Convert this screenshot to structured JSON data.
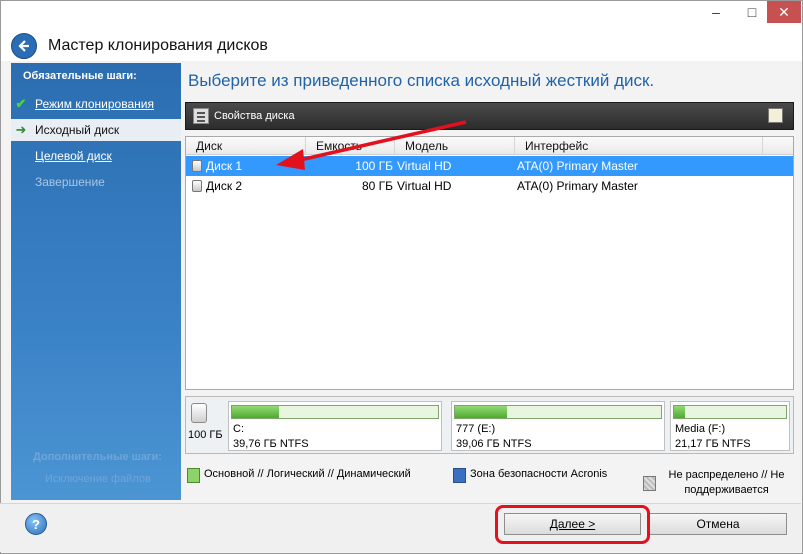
{
  "window": {
    "title": "Мастер клонирования дисков",
    "controls": {
      "minimize": "–",
      "maximize": "□",
      "close": "✕"
    }
  },
  "sidebar": {
    "heading": "Обязательные шаги:",
    "items": [
      {
        "label": "Режим клонирования",
        "state": "done",
        "icon": "check-icon"
      },
      {
        "label": "Исходный диск",
        "state": "active",
        "icon": "arrow-right-icon"
      },
      {
        "label": "Целевой диск",
        "state": "next"
      },
      {
        "label": "Завершение",
        "state": "disabled"
      }
    ],
    "faded_heading": "Дополнительные шаги:",
    "faded_item": "Исключение файлов"
  },
  "main": {
    "instruction": "Выберите из приведенного списка исходный жесткий диск.",
    "toolbar": {
      "label": "Свойства диска"
    },
    "columns": [
      "Диск",
      "Емкость",
      "Модель",
      "Интерфейс"
    ],
    "rows": [
      {
        "disk": "Диск 1",
        "capacity": "100 ГБ",
        "model": "Virtual HD",
        "interface": "ATA(0) Primary Master",
        "selected": true
      },
      {
        "disk": "Диск 2",
        "capacity": "80 ГБ",
        "model": "Virtual HD",
        "interface": "ATA(0) Primary Master",
        "selected": false
      }
    ]
  },
  "diskmap": {
    "capacity": "100 ГБ",
    "partitions": [
      {
        "label": "C:",
        "info": "39,76 ГБ  NTFS",
        "used_fraction": 0.23
      },
      {
        "label": "777 (E:)",
        "info": "39,06 ГБ  NTFS",
        "used_fraction": 0.25
      },
      {
        "label": "Media (F:)",
        "info": "21,17 ГБ  NTFS",
        "used_fraction": 0.1
      }
    ]
  },
  "legend": {
    "primary": "Основной // Логический // Динамический",
    "acronis": "Зона безопасности Acronis",
    "unallocated": "Не распределено // Не поддерживается"
  },
  "footer": {
    "help": "?",
    "next": "Далее >",
    "cancel": "Отмена"
  },
  "colors": {
    "accent": "#1f63a8",
    "selection": "#3399ff",
    "highlight": "#e3101e",
    "partition_fill": "#4fab2e"
  }
}
